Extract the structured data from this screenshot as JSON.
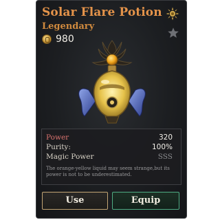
{
  "item": {
    "name": "Solar Flare Potion",
    "rarity": "Legendary",
    "price": "980"
  },
  "colors": {
    "title": "#e4934a",
    "rarity": "#d08a3e",
    "power_label": "#d9736f",
    "use_border": "#c3a574",
    "equip_border": "#4fae84"
  },
  "icons": {
    "rarity_badge": "sun-icon",
    "favorite": "star-icon",
    "currency": "coin-icon"
  },
  "stats": [
    {
      "label": "Power",
      "value": "320"
    },
    {
      "label": "Purity:",
      "value": "100%"
    },
    {
      "label": "Magic Power",
      "value": "SSS"
    }
  ],
  "description": "The orange-yellow liquid may seem strange,but its power is not to be underestimated.",
  "buttons": {
    "use": "Use",
    "equip": "Equip"
  }
}
